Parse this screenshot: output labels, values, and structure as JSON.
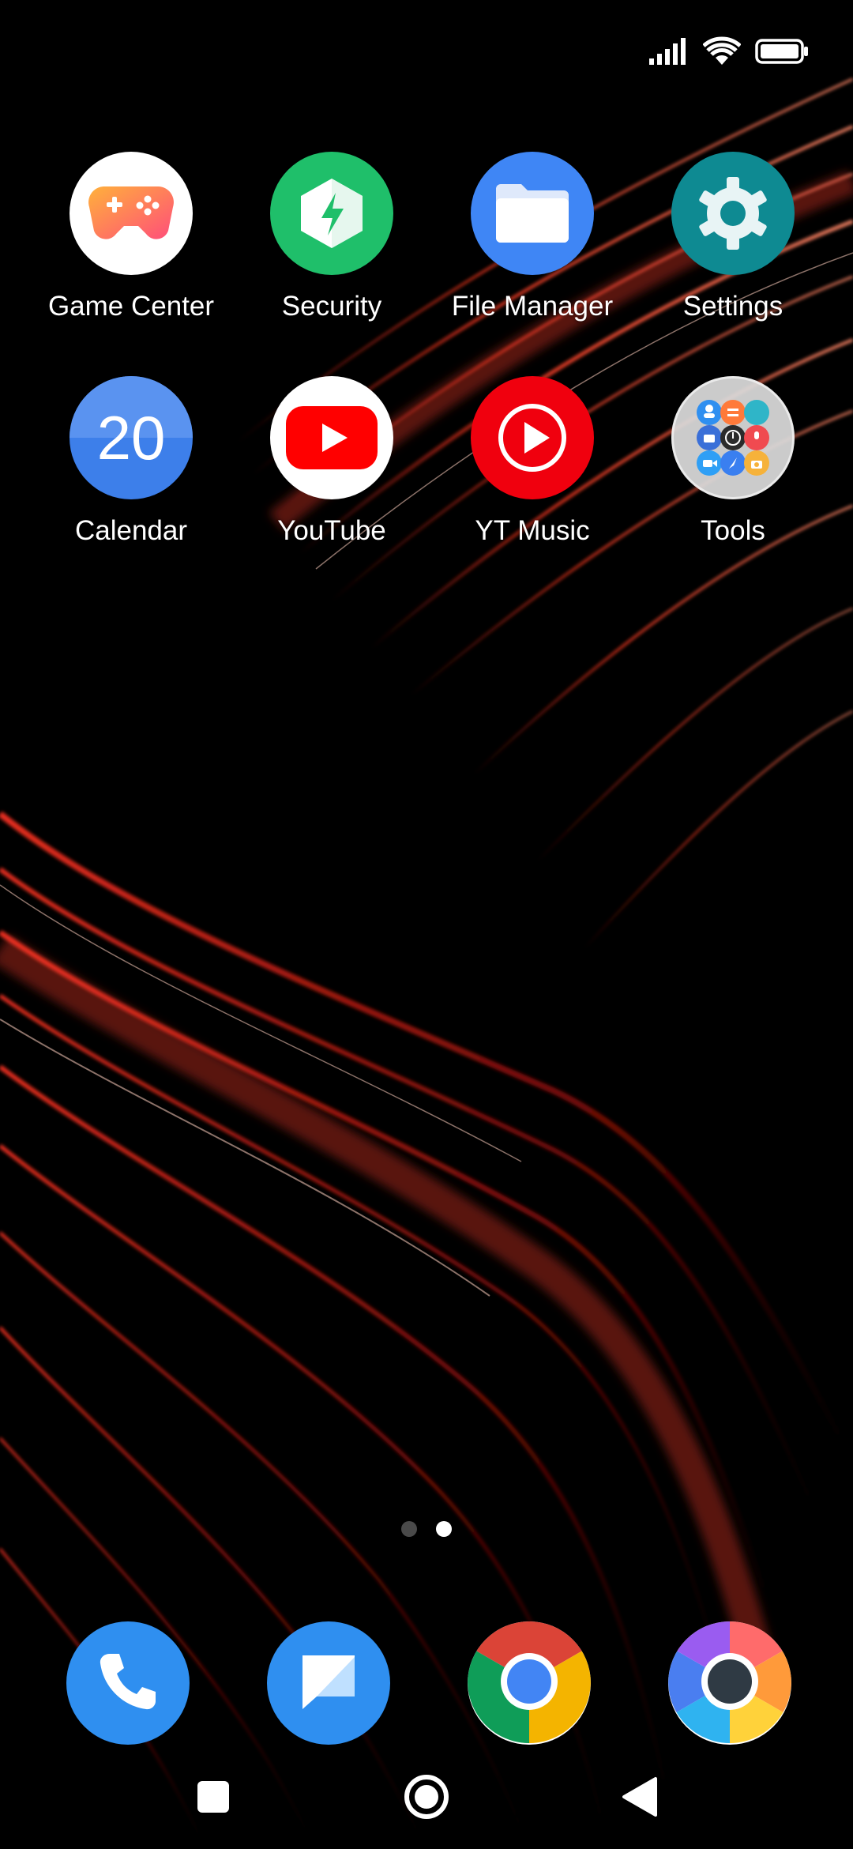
{
  "status_bar": {
    "signal_icon": "cellular-signal-icon",
    "wifi_icon": "wifi-icon",
    "battery_icon": "battery-icon"
  },
  "apps": [
    {
      "label": "Game Center",
      "icon": "game-controller-icon",
      "color": "#ffffff"
    },
    {
      "label": "Security",
      "icon": "security-shield-icon",
      "color": "#1fbf6a"
    },
    {
      "label": "File Manager",
      "icon": "folder-icon",
      "color": "#3f86f5"
    },
    {
      "label": "Settings",
      "icon": "gear-icon",
      "color": "#0e8a92"
    },
    {
      "label": "Calendar",
      "icon": "calendar-icon",
      "color": "#3d7fea",
      "date": "20"
    },
    {
      "label": "YouTube",
      "icon": "youtube-icon",
      "color": "#ffffff"
    },
    {
      "label": "YT Music",
      "icon": "yt-music-icon",
      "color": "#f0000e"
    },
    {
      "label": "Tools",
      "icon": "folder-tools-icon",
      "color": "#c8c8c8"
    }
  ],
  "page_indicator": {
    "pages": 2,
    "current": 2
  },
  "dock": [
    {
      "name": "phone",
      "icon": "phone-icon",
      "color": "#2f8ff0"
    },
    {
      "name": "messages",
      "icon": "messages-icon",
      "color": "#2f8ff0"
    },
    {
      "name": "chrome",
      "icon": "chrome-icon"
    },
    {
      "name": "browser",
      "icon": "browser-icon"
    }
  ],
  "nav": {
    "recents_icon": "recents-square-icon",
    "home_icon": "home-circle-icon",
    "back_icon": "back-triangle-icon"
  }
}
